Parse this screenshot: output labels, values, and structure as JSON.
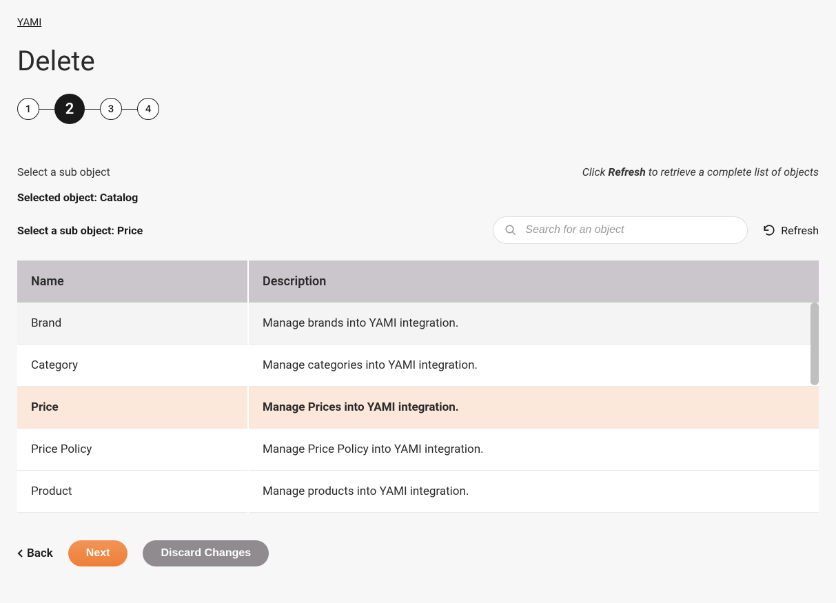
{
  "breadcrumb": "YAMI",
  "page_title": "Delete",
  "stepper": {
    "steps": [
      "1",
      "2",
      "3",
      "4"
    ],
    "active_index": 1
  },
  "section_label": "Select a sub object",
  "hint": {
    "prefix": "Click ",
    "bold": "Refresh",
    "suffix": " to retrieve a complete list of objects"
  },
  "selected_object_label": "Selected object: ",
  "selected_object_value": "Catalog",
  "subobject_label": "Select a sub object: ",
  "subobject_value": "Price",
  "search_placeholder": "Search for an object",
  "refresh_label": "Refresh",
  "table": {
    "headers": {
      "name": "Name",
      "description": "Description"
    },
    "rows": [
      {
        "name": "Brand",
        "description": "Manage brands into YAMI integration.",
        "selected": false
      },
      {
        "name": "Category",
        "description": "Manage categories into YAMI integration.",
        "selected": false
      },
      {
        "name": "Price",
        "description": "Manage Prices into YAMI integration.",
        "selected": true
      },
      {
        "name": "Price Policy",
        "description": "Manage Price Policy into YAMI integration.",
        "selected": false
      },
      {
        "name": "Product",
        "description": "Manage products into YAMI integration.",
        "selected": false
      }
    ]
  },
  "footer": {
    "back": "Back",
    "next": "Next",
    "discard": "Discard Changes"
  }
}
